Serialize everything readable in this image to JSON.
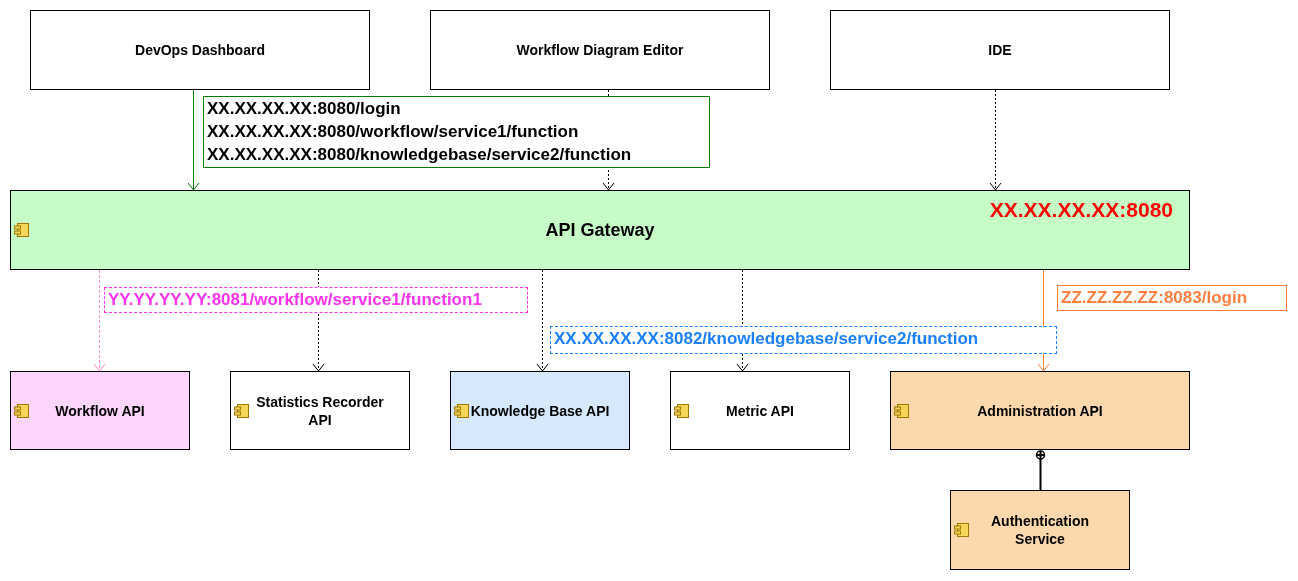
{
  "nodes": [
    {
      "label": "DevOps Dashboard",
      "kind": "client",
      "color": "#ffffff"
    },
    {
      "label": "Workflow Diagram Editor",
      "kind": "client",
      "color": "#ffffff"
    },
    {
      "label": "IDE",
      "kind": "client",
      "color": "#ffffff"
    },
    {
      "label": "API Gateway",
      "kind": "component",
      "color": "#c6fcc6",
      "address": "XX.XX.XX.XX:8080"
    },
    {
      "label": "Workflow API",
      "kind": "component",
      "color": "#fdd5fd"
    },
    {
      "label": "Statistics Recorder API",
      "kind": "component",
      "color": "#ffffff"
    },
    {
      "label": "Knowledge Base API",
      "kind": "component",
      "color": "#d5e8fc"
    },
    {
      "label": "Metric API",
      "kind": "component",
      "color": "#ffffff"
    },
    {
      "label": "Administration API",
      "kind": "component",
      "color": "#fcd8ac"
    },
    {
      "label": "Authentication Service",
      "kind": "component",
      "color": "#fcd8ac"
    }
  ],
  "notes": [
    {
      "lines": [
        "XX.XX.XX.XX:8080/login",
        "XX.XX.XX.XX:8080/workflow/service1/function",
        "XX.XX.XX.XX:8080/knowledgebase/service2/function"
      ],
      "color": "#008000",
      "kind": "solid"
    },
    {
      "lines": [
        "YY.YY.YY.YY:8081/workflow/service1/function1"
      ],
      "color": "#ff33ee",
      "kind": "dashed"
    },
    {
      "lines": [
        "XX.XX.XX.XX:8082/knowledgebase/service2/function"
      ],
      "color": "#1a80ff",
      "kind": "dashed"
    },
    {
      "lines": [
        "ZZ.ZZ.ZZ.ZZ:8083/login"
      ],
      "color": "#ff8040",
      "kind": "solid"
    }
  ],
  "connectors": [
    {
      "kind": "solid",
      "color": "#008000"
    },
    {
      "kind": "dotted",
      "color": "#000000"
    },
    {
      "kind": "dotted",
      "color": "#000000"
    },
    {
      "kind": "dashed",
      "color": "#ff88cc"
    },
    {
      "kind": "dotted",
      "color": "#000000"
    },
    {
      "kind": "dotted",
      "color": "#000000"
    },
    {
      "kind": "dotted",
      "color": "#000000"
    },
    {
      "kind": "solid",
      "color": "#ff8040"
    },
    {
      "kind": "nesting",
      "color": "#000000"
    }
  ]
}
